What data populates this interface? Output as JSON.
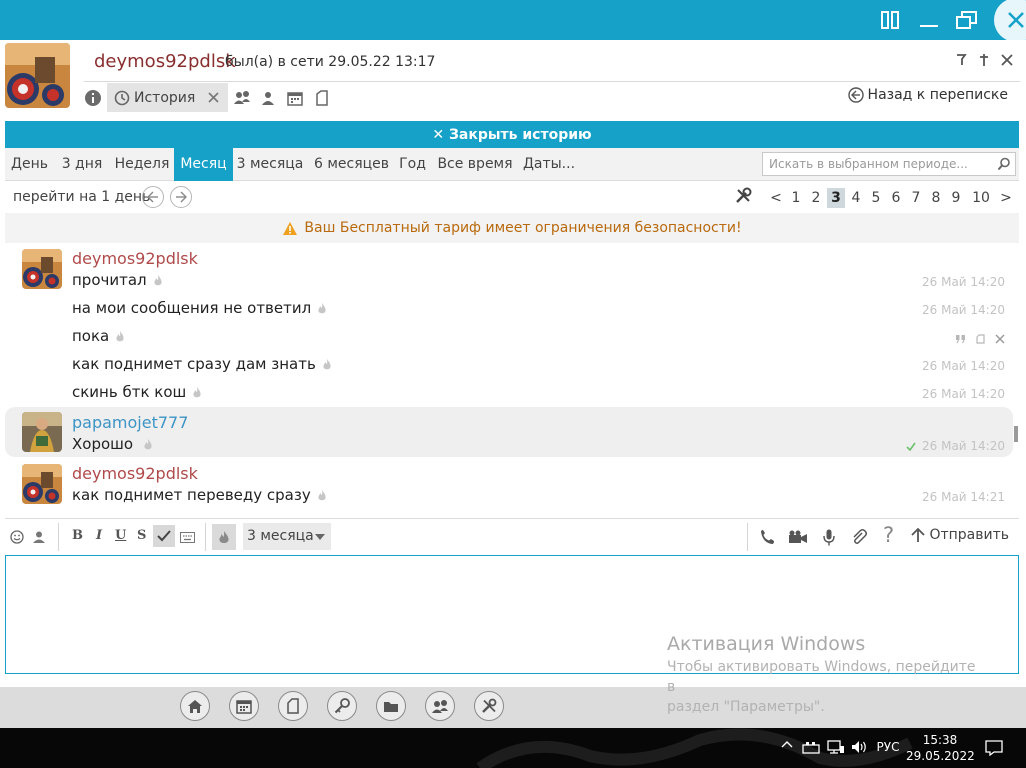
{
  "colors": {
    "accent": "#16a1c9",
    "name_red": "#b04a4a",
    "name_blue": "#3d94c6",
    "warning": "#b96a0e"
  },
  "header": {
    "contact_name": "deymos92pdlsk",
    "status": "был(а) в сети 29.05.22 13:17",
    "history_label": "История",
    "back_label": "Назад к переписке"
  },
  "closebar": {
    "label": "✕ Закрыть историю"
  },
  "period": {
    "tabs": [
      {
        "label": "День"
      },
      {
        "label": "3 дня"
      },
      {
        "label": "Неделя"
      },
      {
        "label": "Месяц",
        "active": true
      },
      {
        "label": "3 месяца"
      },
      {
        "label": "6 месяцев"
      },
      {
        "label": "Год"
      },
      {
        "label": "Все время"
      },
      {
        "label": "Даты..."
      }
    ],
    "search_placeholder": "Искать в выбранном периоде..."
  },
  "nav": {
    "goto_label": "перейти на 1 день",
    "prev": "<",
    "next": ">",
    "pages": [
      "1",
      "2",
      "3",
      "4",
      "5",
      "6",
      "7",
      "8",
      "9",
      "10"
    ],
    "active_page": "3"
  },
  "warning": {
    "text": "Ваш Бесплатный тариф имеет ограничения безопасности!"
  },
  "messages": [
    {
      "author": "deymos92pdlsk",
      "text": "прочитал",
      "time": "26 Май 14:20"
    },
    {
      "text": "на мои сообщения не ответил",
      "time": "26 Май 14:20"
    },
    {
      "text": "пока"
    },
    {
      "text": "как поднимет сразу дам знать",
      "time": "26 Май 14:20"
    },
    {
      "text": "скинь бтк кош",
      "time": "26 Май 14:20"
    },
    {
      "author": "papamojet777",
      "text": "Хорошо",
      "time": "26 Май 14:20"
    },
    {
      "author": "deymos92pdlsk",
      "text": "как поднимет переведу сразу",
      "time": "26 Май 14:21"
    }
  ],
  "composer": {
    "bold": "B",
    "italic": "I",
    "underline": "U",
    "strike": "S",
    "period_select": "3 месяца",
    "send_label": "Отправить",
    "help": "?"
  },
  "watermark": {
    "title": "Активация Windows",
    "line1": "Чтобы активировать Windows, перейдите в",
    "line2": "раздел \"Параметры\"."
  },
  "taskbar": {
    "lang": "РУС",
    "time": "15:38",
    "date": "29.05.2022"
  }
}
